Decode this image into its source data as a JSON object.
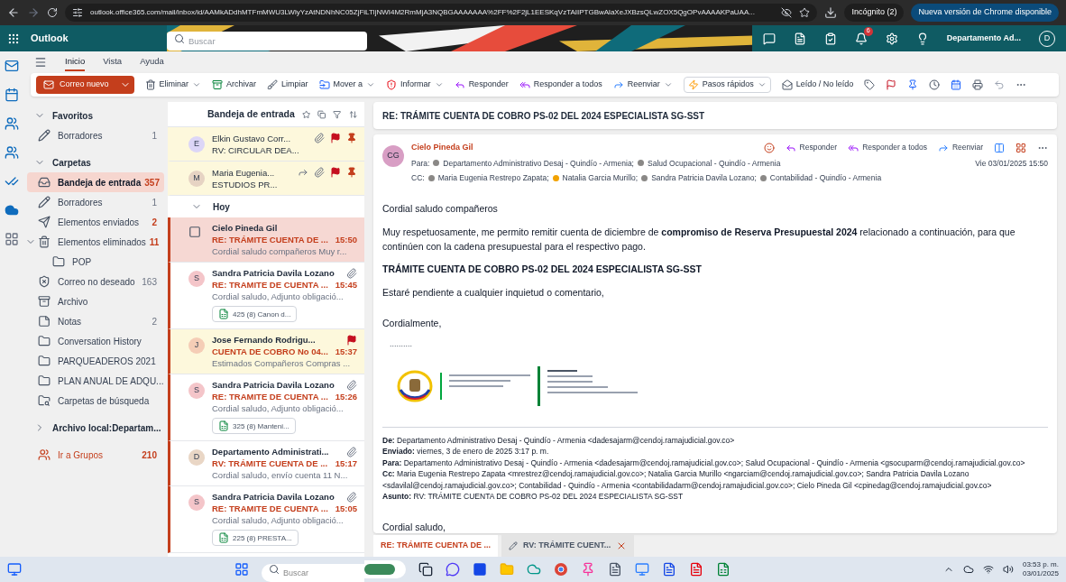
{
  "browser": {
    "url": "outlook.office365.com/mail/inbox/id/AAMkADdhMTFmMWU3LWlyYzAtNDNhNC05ZjFiLTljNWI4M2RmMjA3NQBGAAAAAAA%2FF%2F2jL1EESKqVzTAIIPTGBwAlaXeJXBzsQLwZOX5QgOPvAAAAKPaUAA...",
    "profile": "Incógnito (2)",
    "update": "Nueva versión de Chrome disponible"
  },
  "header": {
    "app": "Outlook",
    "search_placeholder": "Buscar",
    "notifications": "6",
    "account": "Departamento Ad...",
    "avatar": "D"
  },
  "ribbon_tabs": [
    {
      "label": "Inicio",
      "selected": true
    },
    {
      "label": "Vista",
      "selected": false
    },
    {
      "label": "Ayuda",
      "selected": false
    }
  ],
  "toolbar": {
    "new_mail": "Correo nuevo",
    "actions": [
      {
        "label": "Eliminar",
        "kind": "dropdown"
      },
      {
        "label": "Archivar",
        "kind": "button"
      },
      {
        "label": "Limpiar",
        "kind": "button"
      },
      {
        "label": "Mover a",
        "kind": "dropdown"
      },
      {
        "label": "Informar",
        "kind": "dropdown"
      },
      {
        "label": "Responder",
        "kind": "button"
      },
      {
        "label": "Responder a todos",
        "kind": "button"
      },
      {
        "label": "Reenviar",
        "kind": "dropdown"
      },
      {
        "label": "Pasos rápidos",
        "kind": "split"
      },
      {
        "label": "Leído / No leído",
        "kind": "button"
      }
    ]
  },
  "nav": {
    "favorites": {
      "title": "Favoritos",
      "expanded": true,
      "items": [
        {
          "label": "Borradores",
          "count": "1",
          "unread": false,
          "selected": false
        }
      ]
    },
    "folders": {
      "title": "Carpetas",
      "expanded": true,
      "items": [
        {
          "label": "Bandeja de entrada",
          "count": "357",
          "unread": true,
          "selected": true
        },
        {
          "label": "Borradores",
          "count": "1",
          "unread": false,
          "selected": false
        },
        {
          "label": "Elementos enviados",
          "count": "2",
          "unread": true,
          "selected": false
        },
        {
          "label": "Elementos eliminados",
          "count": "11",
          "unread": true,
          "selected": false,
          "expanded": true,
          "children": [
            {
              "label": "POP",
              "selected": false
            }
          ]
        },
        {
          "label": "Correo no deseado",
          "count": "163",
          "unread": false,
          "selected": false
        },
        {
          "label": "Archivo",
          "selected": false
        },
        {
          "label": "Notas",
          "count": "2",
          "unread": false,
          "selected": false
        },
        {
          "label": "Conversation History",
          "selected": false
        },
        {
          "label": "PARQUEADEROS 2021",
          "selected": false
        },
        {
          "label": "PLAN ANUAL DE ADQU...",
          "selected": false
        },
        {
          "label": "Carpetas de búsqueda",
          "selected": false
        }
      ]
    },
    "archive": {
      "title": "Archivo local:Departam...",
      "expanded": false
    },
    "groups": {
      "label": "Ir a Grupos",
      "count": "210"
    }
  },
  "message_list": {
    "title": "Bandeja de entrada",
    "pinned": [
      {
        "avatar": "E",
        "color": "#dcd6f7",
        "sender": "Elkin Gustavo Corr...",
        "subject": "RV: CIRCULAR DEA...",
        "replied": false,
        "attachment": true,
        "flagged": true,
        "pinned": true
      },
      {
        "avatar": "M",
        "color": "#e6d3c3",
        "sender": "Maria Eugenia...",
        "subject": "ESTUDIOS PR...",
        "replied": true,
        "attachment": true,
        "flagged": true,
        "pinned": true
      }
    ],
    "group": {
      "title": "Hoy",
      "expanded": true
    },
    "messages": [
      {
        "sender": "Cielo Pineda Gil",
        "subject": "RE: TRÁMITE CUENTA DE ...",
        "time": "15:50",
        "preview": "Cordial saludo compañeros Muy r...",
        "attachment": false,
        "flagged": false,
        "selected": true,
        "unread": true
      },
      {
        "avatar": "S",
        "color": "#f4c5c9",
        "sender": "Sandra Patricia Davila Lozano",
        "subject": "RE: TRAMITE DE CUENTA ...",
        "time": "15:45",
        "preview": "Cordial saludo, Adjunto obligació...",
        "file": "425 (8) Canon d...",
        "attachment": true,
        "flagged": false,
        "selected": false,
        "unread": true
      },
      {
        "avatar": "J",
        "color": "#f5cdb6",
        "sender": "Jose Fernando Rodrigu...",
        "subject": "CUENTA DE COBRO No 04...",
        "time": "15:37",
        "preview": "Estimados Compañeros Compras ...",
        "attachment": false,
        "flagged": true,
        "selected": false,
        "unread": true
      },
      {
        "avatar": "S",
        "color": "#f4c5c9",
        "sender": "Sandra Patricia Davila Lozano",
        "subject": "RE: TRAMITE DE CUENTA ...",
        "time": "15:26",
        "preview": "Cordial saludo, Adjunto obligació...",
        "file": "325 (8) Manteni...",
        "attachment": true,
        "flagged": false,
        "selected": false,
        "unread": true
      },
      {
        "avatar": "D",
        "color": "#e9d6c5",
        "sender": "Departamento Administrati...",
        "subject": "RV: TRÁMITE CUENTA DE ...",
        "time": "15:17",
        "preview": "Cordial saludo, envío cuenta 11 N...",
        "attachment": true,
        "flagged": false,
        "selected": false,
        "unread": true
      },
      {
        "avatar": "S",
        "color": "#f4c5c9",
        "sender": "Sandra Patricia Davila Lozano",
        "subject": "RE: TRAMITE DE CUENTA ...",
        "time": "15:05",
        "preview": "Cordial saludo, Adjunto obligació...",
        "file": "225 (8) PRESTA...",
        "attachment": true,
        "flagged": false,
        "selected": false,
        "unread": true
      }
    ]
  },
  "reading_pane": {
    "subject": "RE: TRÁMITE CUENTA DE COBRO PS-02 DEL 2024 ESPECIALISTA SG-SST",
    "avatar": "CG",
    "from": "Cielo Pineda Gil",
    "to_label": "Para:",
    "to": [
      {
        "name": "Departamento Administrativo Desaj - Quindío - Armenia;",
        "color": "#8a8886"
      },
      {
        "name": "Salud Ocupacional - Quindío - Armenia",
        "color": "#8a8886"
      }
    ],
    "cc_label": "CC:",
    "cc": [
      {
        "name": "Maria Eugenia Restrepo Zapata;",
        "color": "#8a8886"
      },
      {
        "name": "Natalia Garcia Murillo;",
        "color": "#f2a200"
      },
      {
        "name": "Sandra Patricia Davila Lozano;",
        "color": "#8a8886"
      },
      {
        "name": "Contabilidad - Quindío - Armenia",
        "color": "#8a8886"
      }
    ],
    "actions": [
      "Responder",
      "Responder a todos",
      "Reenviar"
    ],
    "date": "Vie 03/01/2025 15:50",
    "body": [
      "Cordial saludo compañeros",
      "Muy respetuosamente, me permito remitir cuenta de diciembre de **compromiso de Reserva Presupuestal 2024** relacionado a continuación, para que continúen con la cadena presupuestal para el respectivo pago."
    ],
    "heading": "TRÁMITE CUENTA DE COBRO PS-02 DEL 2024 ESPECIALISTA SG-SST",
    "closing": [
      "Estaré pendiente a cualquier inquietud o comentario,",
      "Cordialmente,"
    ],
    "dots": "..........",
    "forwarded": [
      "**De:** Departamento Administrativo Desaj - Quindío - Armenia <dadesajarm@cendoj.ramajudicial.gov.co>",
      "**Enviado:** viernes, 3 de enero de 2025 3:17 p. m.",
      "**Para:** Departamento Administrativo Desaj - Quindío - Armenia <dadesajarm@cendoj.ramajudicial.gov.co>; Salud Ocupacional - Quindío - Armenia <gsocuparm@cendoj.ramajudicial.gov.co>",
      "**Cc:** Maria Eugenia Restrepo Zapata <mrestrez@cendoj.ramajudicial.gov.co>; Natalia Garcia Murillo <ngarciam@cendoj.ramajudicial.gov.co>; Sandra Patricia Davila Lozano <sdavilal@cendoj.ramajudicial.gov.co>; Contabilidad - Quindío - Armenia <contabilidadarm@cendoj.ramajudicial.gov.co>; Cielo Pineda Gil <cpinedag@cendoj.ramajudicial.gov.co>",
      "**Asunto:** RV: TRÁMITE CUENTA DE COBRO PS-02 DEL 2024 ESPECIALISTA SG-SST"
    ],
    "greeting": "Cordial saludo,",
    "tabs": [
      {
        "label": "RE: TRÁMITE CUENTA DE ...",
        "selected": true,
        "draft": false
      },
      {
        "label": "RV: TRÁMITE CUENT...",
        "selected": false,
        "draft": true
      }
    ]
  },
  "taskbar": {
    "search_placeholder": "Buscar",
    "time": "03:53 p. m.",
    "date": "03/01/2025"
  }
}
